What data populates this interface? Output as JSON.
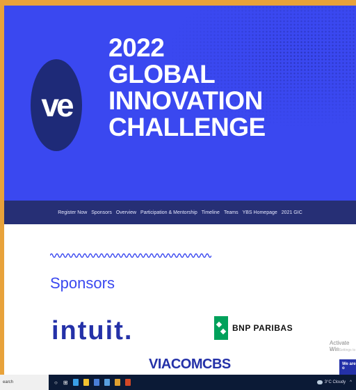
{
  "hero": {
    "logo_text": "ve",
    "title_lines": [
      "2022",
      "GLOBAL",
      "INNOVATION",
      "CHALLENGE"
    ]
  },
  "nav": {
    "items": [
      {
        "label": "Register Now"
      },
      {
        "label": "Sponsors"
      },
      {
        "label": "Overview"
      },
      {
        "label": "Participation & Mentorship"
      },
      {
        "label": "Timeline"
      },
      {
        "label": "Teams"
      },
      {
        "label": "YBS Homepage"
      },
      {
        "label": "2021 GIC"
      }
    ]
  },
  "sponsors": {
    "heading": "Sponsors",
    "intuit": "intuit.",
    "bnp": "BNP PARIBAS",
    "viacom": "VIACOMCBS"
  },
  "overlay": {
    "activate": "Activate Win",
    "activate_sub": "Go to Settings to",
    "chat": "We are o"
  },
  "taskbar": {
    "search": "earch",
    "weather": "3°C Cloudy",
    "apps": [
      {
        "name": "edge-icon",
        "color": "#3aa0e8"
      },
      {
        "name": "file-explorer-icon",
        "color": "#f2c230"
      },
      {
        "name": "store-icon",
        "color": "#4a7fd8"
      },
      {
        "name": "mail-icon",
        "color": "#5aa0e0"
      },
      {
        "name": "chrome-icon",
        "color": "#e0a030"
      },
      {
        "name": "powerpoint-icon",
        "color": "#d24726"
      }
    ]
  },
  "colors": {
    "hero_bg": "#3a48f0",
    "nav_bg": "#262f75",
    "brand": "#2431a8",
    "page_border": "#e8a23a"
  }
}
